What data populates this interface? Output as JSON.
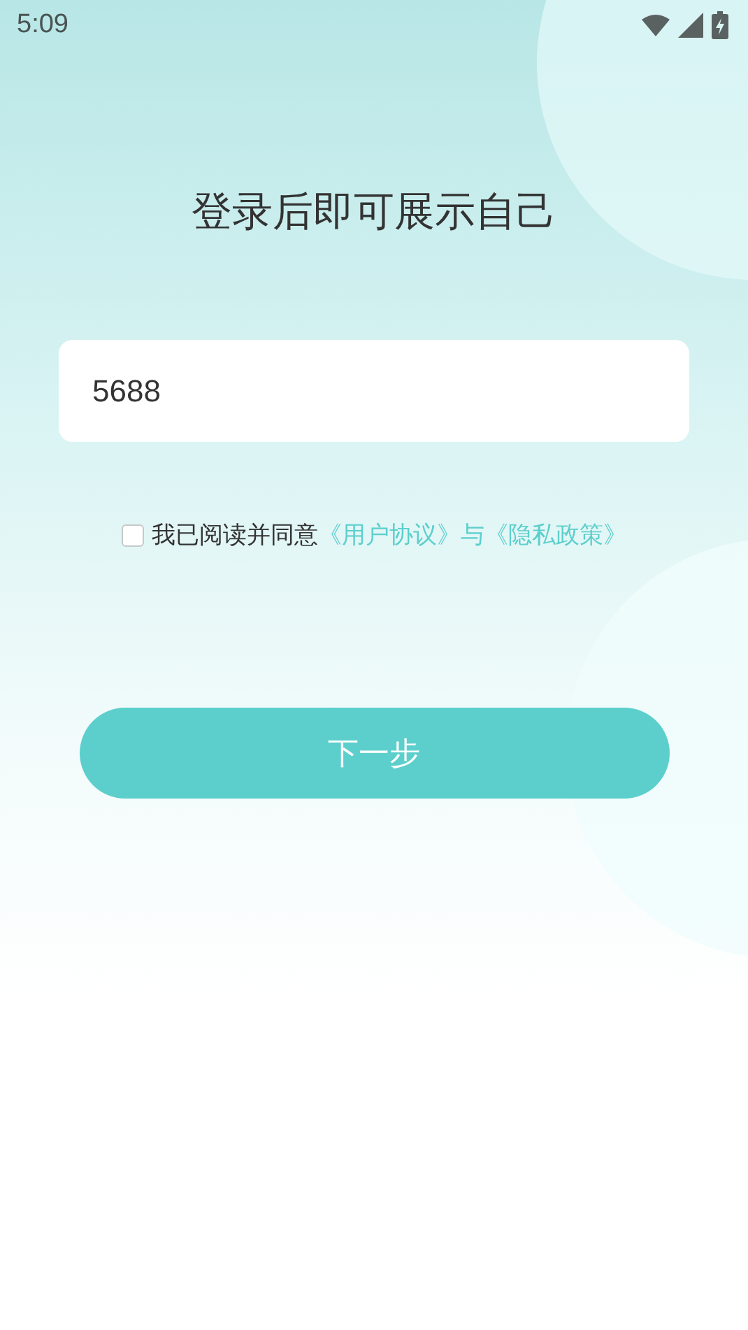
{
  "status_bar": {
    "time": "5:09"
  },
  "title": "登录后即可展示自己",
  "phone_field": {
    "value": "5688"
  },
  "agreement": {
    "checked": false,
    "text": "我已阅读并同意",
    "links": [
      "《用户协议》",
      "《隐私政策》"
    ],
    "joiner": "与"
  },
  "next_button": {
    "label": "下一步"
  }
}
